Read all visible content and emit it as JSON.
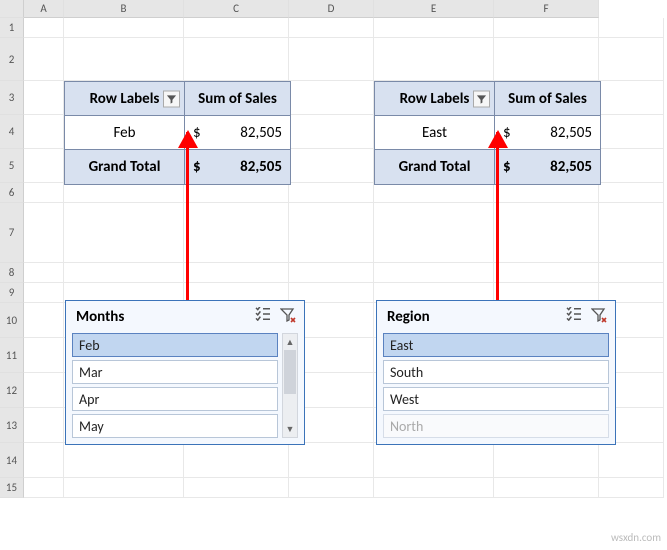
{
  "columns": [
    "A",
    "B",
    "C",
    "D",
    "E",
    "F"
  ],
  "rows": [
    1,
    2,
    3,
    4,
    5,
    6,
    7,
    8,
    9,
    10,
    11,
    12,
    13,
    14,
    15
  ],
  "pivot1": {
    "rowLabelHeader": "Row Labels",
    "sumHeader": "Sum of Sales",
    "dataLabel": "Feb",
    "grandLabel": "Grand Total",
    "currency": "$",
    "value": "82,505",
    "total": "82,505"
  },
  "pivot2": {
    "rowLabelHeader": "Row Labels",
    "sumHeader": "Sum of Sales",
    "dataLabel": "East",
    "grandLabel": "Grand Total",
    "currency": "$",
    "value": "82,505",
    "total": "82,505"
  },
  "slicer1": {
    "title": "Months",
    "items": [
      {
        "label": "Feb",
        "selected": true
      },
      {
        "label": "Mar",
        "selected": false
      },
      {
        "label": "Apr",
        "selected": false
      },
      {
        "label": "May",
        "selected": false
      }
    ]
  },
  "slicer2": {
    "title": "Region",
    "items": [
      {
        "label": "East",
        "selected": true
      },
      {
        "label": "South",
        "selected": false
      },
      {
        "label": "West",
        "selected": false
      },
      {
        "label": "North",
        "selected": false,
        "dim": true
      }
    ]
  },
  "watermark": "wsxdn.com"
}
